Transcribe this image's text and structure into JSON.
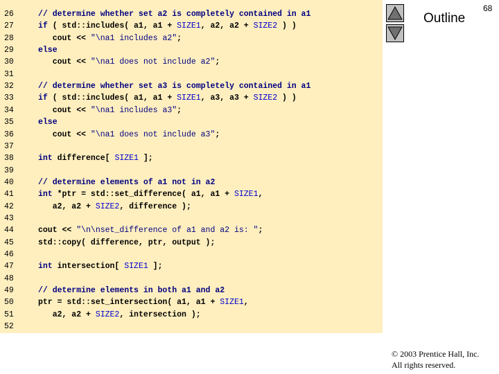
{
  "slide": {
    "outline_label": "Outline",
    "page_number": "68",
    "copyright_line1": "© 2003 Prentice Hall, Inc.",
    "copyright_line2": "All rights reserved."
  },
  "nav": {
    "up_icon": "triangle-up-icon",
    "down_icon": "triangle-down-icon"
  },
  "colors": {
    "code_background": "#ffefbf",
    "keyword": "#000080",
    "constant": "#0000d0",
    "button": "#c0c0c0"
  },
  "code_lines": [
    {
      "num": "26",
      "segs": [
        {
          "t": "comment",
          "s": "// determine whether set a2 is completely contained in a1"
        }
      ]
    },
    {
      "num": "27",
      "segs": [
        {
          "t": "kw",
          "s": "if"
        },
        {
          "t": "plain",
          "s": " ( std::includes( a1, a1 + "
        },
        {
          "t": "const",
          "s": "SIZE1"
        },
        {
          "t": "plain",
          "s": ", a2, a2 + "
        },
        {
          "t": "const",
          "s": "SIZE2"
        },
        {
          "t": "plain",
          "s": " ) )"
        }
      ]
    },
    {
      "num": "28",
      "segs": [
        {
          "t": "plain",
          "s": "   cout << "
        },
        {
          "t": "str",
          "s": "\"\\na1 includes a2\""
        },
        {
          "t": "plain",
          "s": ";"
        }
      ]
    },
    {
      "num": "29",
      "segs": [
        {
          "t": "kw",
          "s": "else"
        }
      ]
    },
    {
      "num": "30",
      "segs": [
        {
          "t": "plain",
          "s": "   cout << "
        },
        {
          "t": "str",
          "s": "\"\\na1 does not include a2\""
        },
        {
          "t": "plain",
          "s": ";"
        }
      ]
    },
    {
      "num": "31",
      "segs": []
    },
    {
      "num": "32",
      "segs": [
        {
          "t": "comment",
          "s": "// determine whether set a3 is completely contained in a1"
        }
      ]
    },
    {
      "num": "33",
      "segs": [
        {
          "t": "kw",
          "s": "if"
        },
        {
          "t": "plain",
          "s": " ( std::includes( a1, a1 + "
        },
        {
          "t": "const",
          "s": "SIZE1"
        },
        {
          "t": "plain",
          "s": ", a3, a3 + "
        },
        {
          "t": "const",
          "s": "SIZE2"
        },
        {
          "t": "plain",
          "s": " ) )"
        }
      ]
    },
    {
      "num": "34",
      "segs": [
        {
          "t": "plain",
          "s": "   cout << "
        },
        {
          "t": "str",
          "s": "\"\\na1 includes a3\""
        },
        {
          "t": "plain",
          "s": ";"
        }
      ]
    },
    {
      "num": "35",
      "segs": [
        {
          "t": "kw",
          "s": "else"
        }
      ]
    },
    {
      "num": "36",
      "segs": [
        {
          "t": "plain",
          "s": "   cout << "
        },
        {
          "t": "str",
          "s": "\"\\na1 does not include a3\""
        },
        {
          "t": "plain",
          "s": ";"
        }
      ]
    },
    {
      "num": "37",
      "segs": []
    },
    {
      "num": "38",
      "segs": [
        {
          "t": "kw",
          "s": "int"
        },
        {
          "t": "plain",
          "s": " difference[ "
        },
        {
          "t": "const",
          "s": "SIZE1"
        },
        {
          "t": "plain",
          "s": " ];"
        }
      ]
    },
    {
      "num": "39",
      "segs": []
    },
    {
      "num": "40",
      "segs": [
        {
          "t": "comment",
          "s": "// determine elements of a1 not in a2"
        }
      ]
    },
    {
      "num": "41",
      "segs": [
        {
          "t": "kw",
          "s": "int"
        },
        {
          "t": "plain",
          "s": " *ptr = std::set_difference( a1, a1 + "
        },
        {
          "t": "const",
          "s": "SIZE1"
        },
        {
          "t": "plain",
          "s": ","
        }
      ]
    },
    {
      "num": "42",
      "segs": [
        {
          "t": "plain",
          "s": "   a2, a2 + "
        },
        {
          "t": "const",
          "s": "SIZE2"
        },
        {
          "t": "plain",
          "s": ", difference );"
        }
      ]
    },
    {
      "num": "43",
      "segs": []
    },
    {
      "num": "44",
      "segs": [
        {
          "t": "plain",
          "s": "cout << "
        },
        {
          "t": "str",
          "s": "\"\\n\\nset_difference of a1 and a2 is: \""
        },
        {
          "t": "plain",
          "s": ";"
        }
      ]
    },
    {
      "num": "45",
      "segs": [
        {
          "t": "plain",
          "s": "std::copy( difference, ptr, output );"
        }
      ]
    },
    {
      "num": "46",
      "segs": []
    },
    {
      "num": "47",
      "segs": [
        {
          "t": "kw",
          "s": "int"
        },
        {
          "t": "plain",
          "s": " intersection[ "
        },
        {
          "t": "const",
          "s": "SIZE1"
        },
        {
          "t": "plain",
          "s": " ];"
        }
      ]
    },
    {
      "num": "48",
      "segs": []
    },
    {
      "num": "49",
      "segs": [
        {
          "t": "comment",
          "s": "// determine elements in both a1 and a2"
        }
      ]
    },
    {
      "num": "50",
      "segs": [
        {
          "t": "plain",
          "s": "ptr = std::set_intersection( a1, a1 + "
        },
        {
          "t": "const",
          "s": "SIZE1"
        },
        {
          "t": "plain",
          "s": ","
        }
      ]
    },
    {
      "num": "51",
      "segs": [
        {
          "t": "plain",
          "s": "   a2, a2 + "
        },
        {
          "t": "const",
          "s": "SIZE2"
        },
        {
          "t": "plain",
          "s": ", intersection );"
        }
      ]
    },
    {
      "num": "52",
      "segs": []
    }
  ]
}
